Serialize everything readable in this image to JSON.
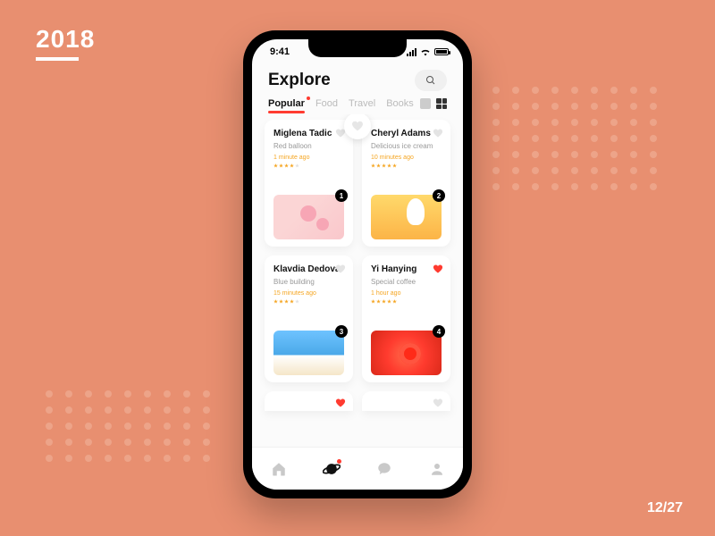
{
  "meta": {
    "year": "2018",
    "date": "12/27"
  },
  "status": {
    "time": "9:41"
  },
  "header": {
    "title": "Explore"
  },
  "tabs": {
    "items": [
      "Popular",
      "Food",
      "Travel",
      "Books"
    ],
    "active_index": 0
  },
  "cards": [
    {
      "author": "Miglena Tadic",
      "title": "Red balloon",
      "time": "1 minute ago",
      "stars": 4,
      "rank": "1",
      "liked": false
    },
    {
      "author": "Cheryl Adams",
      "title": "Delicious ice cream",
      "time": "10 minutes ago",
      "stars": 5,
      "rank": "2",
      "liked": false
    },
    {
      "author": "Klavdia Dedova",
      "title": "Blue building",
      "time": "15 minutes ago",
      "stars": 4,
      "rank": "3",
      "liked": false
    },
    {
      "author": "Yi Hanying",
      "title": "Special coffee",
      "time": "1 hour ago",
      "stars": 5,
      "rank": "4",
      "liked": true
    }
  ],
  "nav": {
    "active_index": 1
  }
}
